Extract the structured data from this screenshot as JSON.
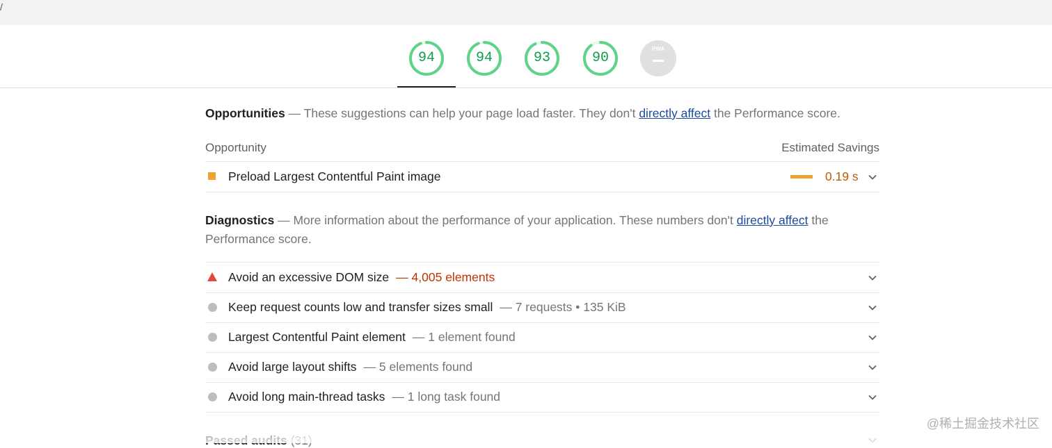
{
  "top": {
    "mark": "/"
  },
  "gauges": [
    {
      "score": "94",
      "fraction": 0.94
    },
    {
      "score": "94",
      "fraction": 0.94
    },
    {
      "score": "93",
      "fraction": 0.93
    },
    {
      "score": "90",
      "fraction": 0.9
    }
  ],
  "pwa": {
    "label": "PWA",
    "value": "—"
  },
  "colors": {
    "pass": "#0c9d4c",
    "pass_ring": "#5fd38a",
    "warn": "#f0a230",
    "fail": "#e3483d",
    "link": "#1a4a9b"
  },
  "opportunities": {
    "title": "Opportunities",
    "dash": "—",
    "desc_before": "These suggestions can help your page load faster. They don't",
    "link": "directly affect",
    "desc_after": "the Performance score.",
    "col_left": "Opportunity",
    "col_right": "Estimated Savings",
    "items": [
      {
        "label": "Preload Largest Contentful Paint image",
        "savings": "0.19 s"
      }
    ]
  },
  "diagnostics": {
    "title": "Diagnostics",
    "dash": "—",
    "desc_before": "More information about the performance of your application. These numbers don't",
    "link": "directly affect",
    "desc_after": "the Performance score.",
    "items": [
      {
        "label": "Avoid an excessive DOM size",
        "detail": "4,005 elements",
        "icon": "fail-triangle-icon"
      },
      {
        "label": "Keep request counts low and transfer sizes small",
        "detail": "7 requests • 135 KiB",
        "icon": "info-dot-icon"
      },
      {
        "label": "Largest Contentful Paint element",
        "detail": "1 element found",
        "icon": "info-dot-icon"
      },
      {
        "label": "Avoid large layout shifts",
        "detail": "5 elements found",
        "icon": "info-dot-icon"
      },
      {
        "label": "Avoid long main-thread tasks",
        "detail": "1 long task found",
        "icon": "info-dot-icon"
      }
    ]
  },
  "passed": {
    "title": "Passed audits",
    "count": "(31)"
  },
  "watermark": "@稀土掘金技术社区"
}
